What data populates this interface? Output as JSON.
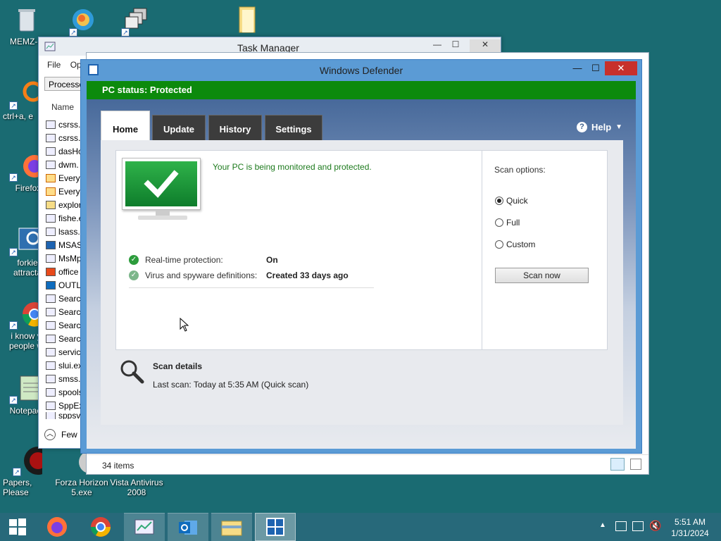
{
  "desktop": {
    "icons": [
      {
        "label": "MEMZ-D",
        "icon": "recycle-bin-icon"
      },
      {
        "label": "ctrl+a, e",
        "icon": "orange-ring-icon"
      },
      {
        "label": "Firefox",
        "icon": "firefox-icon"
      },
      {
        "label": "forkie attracta",
        "icon": "settings-app-icon"
      },
      {
        "label": "i know y people w",
        "icon": "chrome-icon"
      },
      {
        "label": "Notepac",
        "icon": "notepad-icon"
      },
      {
        "label": "Papers, Please",
        "icon": "papers-please-icon"
      },
      {
        "label": "Forza Horizon 5.exe",
        "icon": "forza-icon"
      },
      {
        "label": "Vista Antivirus 2008",
        "icon": "antivirus-icon"
      }
    ]
  },
  "task_manager": {
    "title": "Task Manager",
    "menu": [
      "File",
      "Op"
    ],
    "tab": "Processe",
    "column": "Name",
    "processes": [
      "csrss.e",
      "csrss.e",
      "dasHo",
      "dwm.",
      "Everyt",
      "Everyt",
      "explor",
      "fishe.e",
      "lsass.e",
      "MSAS",
      "MsMp",
      "office",
      "OUTL",
      "Search",
      "Search",
      "Search",
      "Search",
      "servic",
      "slui.ex",
      "smss.e",
      "spools",
      "SppEx",
      "sppsv"
    ],
    "footer": "Few"
  },
  "explorer": {
    "status_items": "34 items"
  },
  "defender": {
    "title": "Windows Defender",
    "status": "PC status: Protected",
    "status_color": "#0c8a0c",
    "tabs": [
      "Home",
      "Update",
      "History",
      "Settings"
    ],
    "active_tab": "Home",
    "help": "Help",
    "message": "Your PC is being monitored and protected.",
    "realtime_label": "Real-time protection:",
    "realtime_value": "On",
    "definitions_label": "Virus and spyware definitions:",
    "definitions_value": "Created 33 days ago",
    "scan_options_label": "Scan options:",
    "scan_options": [
      "Quick",
      "Full",
      "Custom"
    ],
    "selected_option": "Quick",
    "scan_now": "Scan now",
    "scan_details_title": "Scan details",
    "last_scan": "Last scan:  Today at 5:35 AM (Quick scan)"
  },
  "taskbar": {
    "time": "5:51 AM",
    "date": "1/31/2024"
  }
}
